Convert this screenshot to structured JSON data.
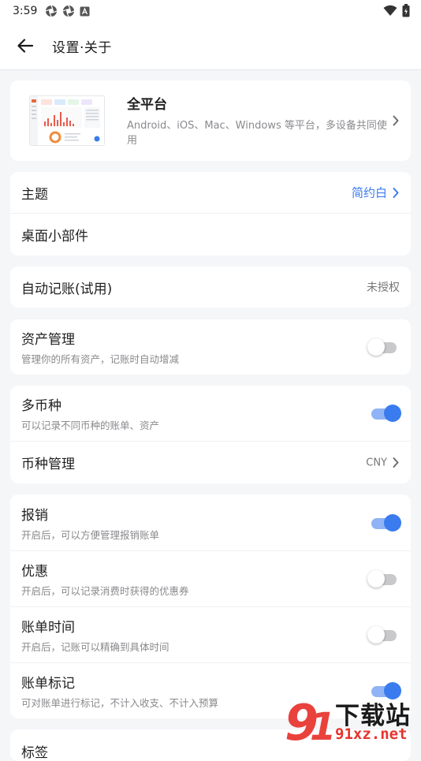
{
  "status_bar": {
    "time": "3:59",
    "icons": [
      "aperture-icon",
      "aperture-icon",
      "app-notification-icon",
      "wifi-icon",
      "battery-icon"
    ]
  },
  "app_bar": {
    "title": "设置·关于",
    "back_icon": "arrow-left-icon"
  },
  "promo": {
    "title": "全平台",
    "description": "Android、iOS、Mac、Windows 等平台，多设备共同使用"
  },
  "settings_groups": [
    {
      "rows": [
        {
          "label": "主题",
          "value": "简约白",
          "chevron": true
        },
        {
          "label": "桌面小部件"
        }
      ]
    },
    {
      "rows": [
        {
          "label": "自动记账(试用)",
          "value": "未授权"
        }
      ]
    },
    {
      "rows": [
        {
          "label": "资产管理",
          "subtitle": "管理你的所有资产，记账时自动增减",
          "toggle": false
        }
      ]
    },
    {
      "rows": [
        {
          "label": "多币种",
          "subtitle": "可以记录不同币种的账单、资产",
          "toggle": true
        },
        {
          "label": "币种管理",
          "value": "CNY",
          "chevron": true
        }
      ]
    },
    {
      "rows": [
        {
          "label": "报销",
          "subtitle": "开启后，可以方便管理报销账单",
          "toggle": true
        },
        {
          "label": "优惠",
          "subtitle": "开启后，可以记录消费时获得的优惠券",
          "toggle": false
        },
        {
          "label": "账单时间",
          "subtitle": "开启后，记账可以精确到具体时间",
          "toggle": false
        },
        {
          "label": "账单标记",
          "subtitle": "可对账单进行标记，不计入收支、不计入预算",
          "toggle": true
        }
      ]
    },
    {
      "rows": [
        {
          "label": "标签"
        }
      ]
    }
  ],
  "watermark": {
    "text": "下载站",
    "domain": "91xz.net"
  },
  "colors": {
    "accent": "#3a7bf0",
    "background": "#f5f6f8",
    "card": "#ffffff",
    "toggle_off_track": "#c9c9cc",
    "watermark_red": "#e8322c"
  }
}
